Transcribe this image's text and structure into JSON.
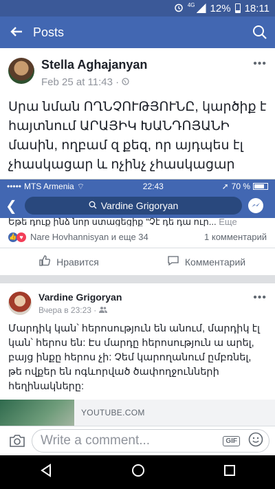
{
  "status_bar": {
    "lte": "4G",
    "battery": "12%",
    "time": "18:11"
  },
  "header": {
    "title": "Posts",
    "back_icon": "arrow-left-icon",
    "search_icon": "search-icon"
  },
  "post1": {
    "author": "Stella Aghajanyan",
    "time": "Feb 25 at 11:43",
    "privacy": "·",
    "body": "Սրա նման ՈՂՆՉՈՒԹՅՈՒՆԸ, կարծիք է հայտնում ԱՐԱՅԻԿ ԽԱՆԴՈՅԱՆԻ մասին, ողբամ զ քեզ, որ այդպես էլ չհասկացար և ոչինչ չհասկացար"
  },
  "embedded": {
    "carrier": "MTS Armenia",
    "time": "22:43",
    "battery": "70 %",
    "search_text": "Vardine Grigoryan",
    "clip_text": "Եթե դուք ինձ նոր ստացեցիք \"Չէ դե դա ուր...",
    "clip_more": "Еще",
    "reactions": "Nare Hovhannisyan и еще 34",
    "comments": "1 комментарий",
    "like_label": "Нравится",
    "comment_label": "Комментарий"
  },
  "post2": {
    "author": "Vardine Grigoryan",
    "time": "Вчера в 23:23 ·",
    "body": "Մարդիկ կան՝ հերոսություն են անում, մարդիկ էլ կան՝ հերոս են: Էս մարդը հերոսություն ա արել, բայց ինքը հերոս չի: Չեմ կարողանում ըմբռնել, թե ովքեր են ոգևորված ծափողջունների հեղինակները:",
    "link_source": "YOUTUBE.COM"
  },
  "comment_bar": {
    "placeholder": "Write a comment...",
    "gif": "GIF"
  },
  "colors": {
    "brand": "#4267b2",
    "status": "#3b5998"
  }
}
